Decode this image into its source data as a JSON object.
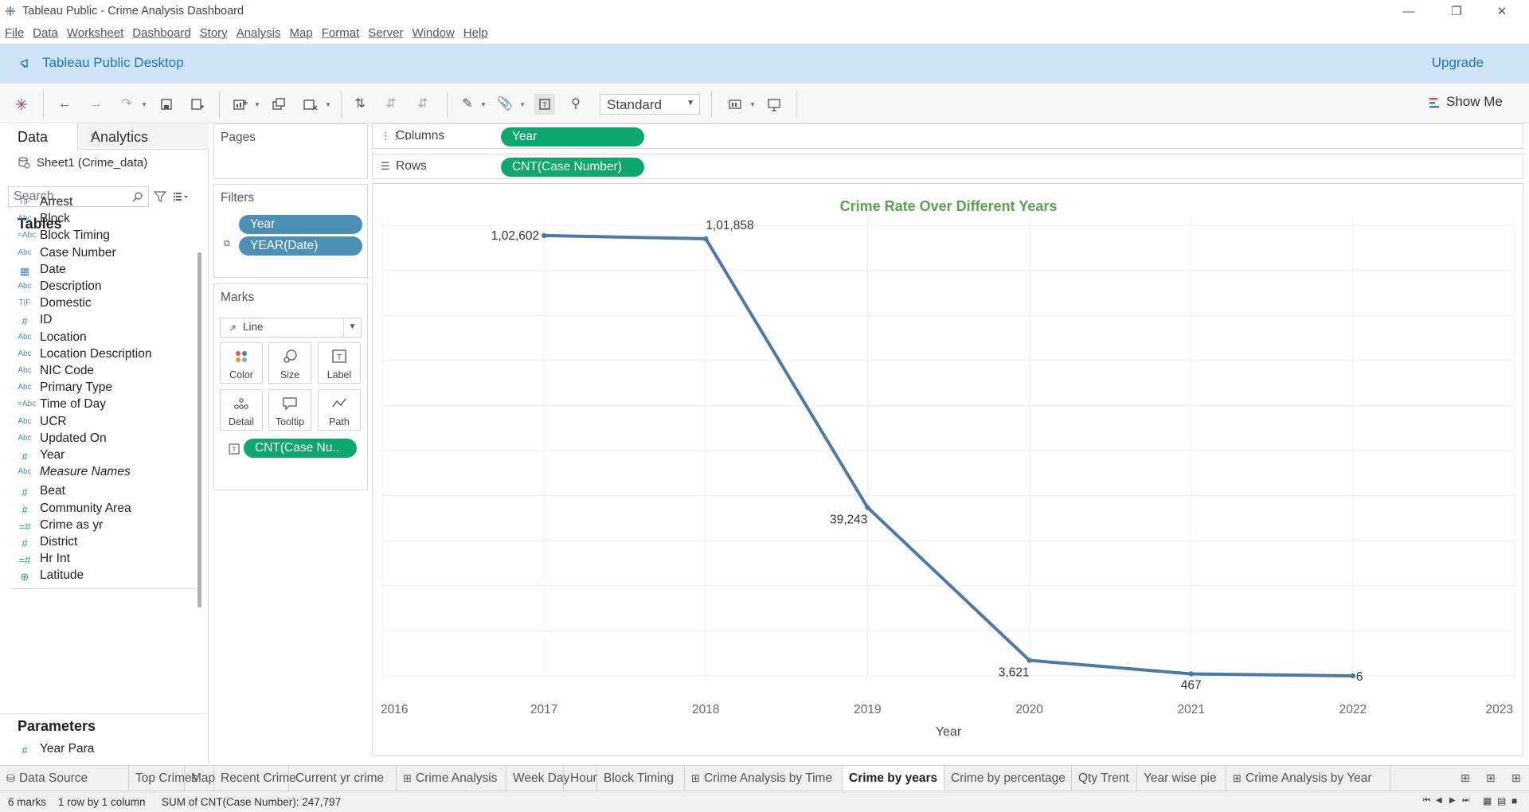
{
  "window": {
    "title": "Tableau Public - Crime Analysis Dashboard",
    "controls": [
      "minimize-icon",
      "restore-icon",
      "close-icon"
    ]
  },
  "menu": [
    "File",
    "Data",
    "Worksheet",
    "Dashboard",
    "Story",
    "Analysis",
    "Map",
    "Format",
    "Server",
    "Window",
    "Help"
  ],
  "banner": {
    "title": "Tableau Public Desktop",
    "upgrade": "Upgrade"
  },
  "toolbar": {
    "fit_select": "Standard",
    "show_me": "Show Me"
  },
  "data_pane": {
    "tab_data": "Data",
    "tab_analytics": "Analytics",
    "datasource": "Sheet1 (Crime_data)",
    "search_placeholder": "Search",
    "tables_heading": "Tables",
    "fields": [
      {
        "icon": "T|F",
        "name": "Arrest"
      },
      {
        "icon": "Abc",
        "name": "Block"
      },
      {
        "icon": "=Abc",
        "name": "Block Timing"
      },
      {
        "icon": "Abc",
        "name": "Case Number"
      },
      {
        "icon": "date",
        "name": "Date"
      },
      {
        "icon": "Abc",
        "name": "Description"
      },
      {
        "icon": "T|F",
        "name": "Domestic"
      },
      {
        "icon": "#",
        "name": "ID"
      },
      {
        "icon": "Abc",
        "name": "Location"
      },
      {
        "icon": "Abc",
        "name": "Location Description"
      },
      {
        "icon": "Abc",
        "name": "NIC Code"
      },
      {
        "icon": "Abc",
        "name": "Primary Type"
      },
      {
        "icon": "=Abc",
        "name": "Time of Day"
      },
      {
        "icon": "Abc",
        "name": "UCR"
      },
      {
        "icon": "Abc",
        "name": "Updated On"
      },
      {
        "icon": "#",
        "name": "Year"
      },
      {
        "icon": "Abc",
        "name": "Measure Names"
      },
      {
        "icon": "#",
        "name": "Beat"
      },
      {
        "icon": "#",
        "name": "Community Area"
      },
      {
        "icon": "=#",
        "name": "Crime as yr"
      },
      {
        "icon": "#",
        "name": "District"
      },
      {
        "icon": "=#",
        "name": "Hr Int"
      },
      {
        "icon": "globe",
        "name": "Latitude"
      }
    ],
    "parameters_heading": "Parameters",
    "parameters": [
      {
        "icon": "#",
        "name": "Year Para"
      }
    ]
  },
  "pages": {
    "title": "Pages"
  },
  "filters": {
    "title": "Filters",
    "pills": [
      "Year",
      "YEAR(Date)"
    ]
  },
  "marks": {
    "title": "Marks",
    "type": "Line",
    "buttons": [
      "Color",
      "Size",
      "Label",
      "Detail",
      "Tooltip",
      "Path"
    ],
    "label_pill": "CNT(Case Nu.."
  },
  "shelves": {
    "columns_label": "Columns",
    "columns_pill": "Year",
    "rows_label": "Rows",
    "rows_pill": "CNT(Case Number)"
  },
  "chart_data": {
    "type": "line",
    "title": "Crime Rate Over Different Years",
    "xlabel": "Year",
    "ylabel": "",
    "x": [
      2017,
      2018,
      2019,
      2020,
      2021,
      2022
    ],
    "values": [
      102602,
      101858,
      39243,
      3621,
      467,
      6
    ],
    "labels": [
      "1,02,602",
      "1,01,858",
      "39,243",
      "3,621",
      "467",
      "6"
    ],
    "xticks": [
      "2016",
      "2017",
      "2018",
      "2019",
      "2020",
      "2021",
      "2022",
      "2023"
    ],
    "xlim": [
      2016,
      2023
    ],
    "ylim": [
      0,
      105000
    ],
    "grid": true,
    "title_color": "#59a14f",
    "line_color": "#4e79a7"
  },
  "sheet_tabs": [
    {
      "label": "Data Source",
      "icon": "datasource-icon"
    },
    {
      "label": "Top Crimes"
    },
    {
      "label": "Map"
    },
    {
      "label": "Recent Crime"
    },
    {
      "label": "Current yr crime"
    },
    {
      "label": "Crime Analysis",
      "icon": "dashboard-icon"
    },
    {
      "label": "Week Day"
    },
    {
      "label": "Hour"
    },
    {
      "label": "Block Timing"
    },
    {
      "label": "Crime Analysis by Time",
      "icon": "dashboard-icon"
    },
    {
      "label": "Crime by years",
      "active": true
    },
    {
      "label": "Crime by percentage"
    },
    {
      "label": "Qty Trent"
    },
    {
      "label": "Year wise pie"
    },
    {
      "label": "Crime Analysis by Year",
      "icon": "dashboard-icon"
    }
  ],
  "status": {
    "marks": "6 marks",
    "rows_cols": "1 row by 1 column",
    "sum": "SUM of CNT(Case Number): 247,797"
  }
}
